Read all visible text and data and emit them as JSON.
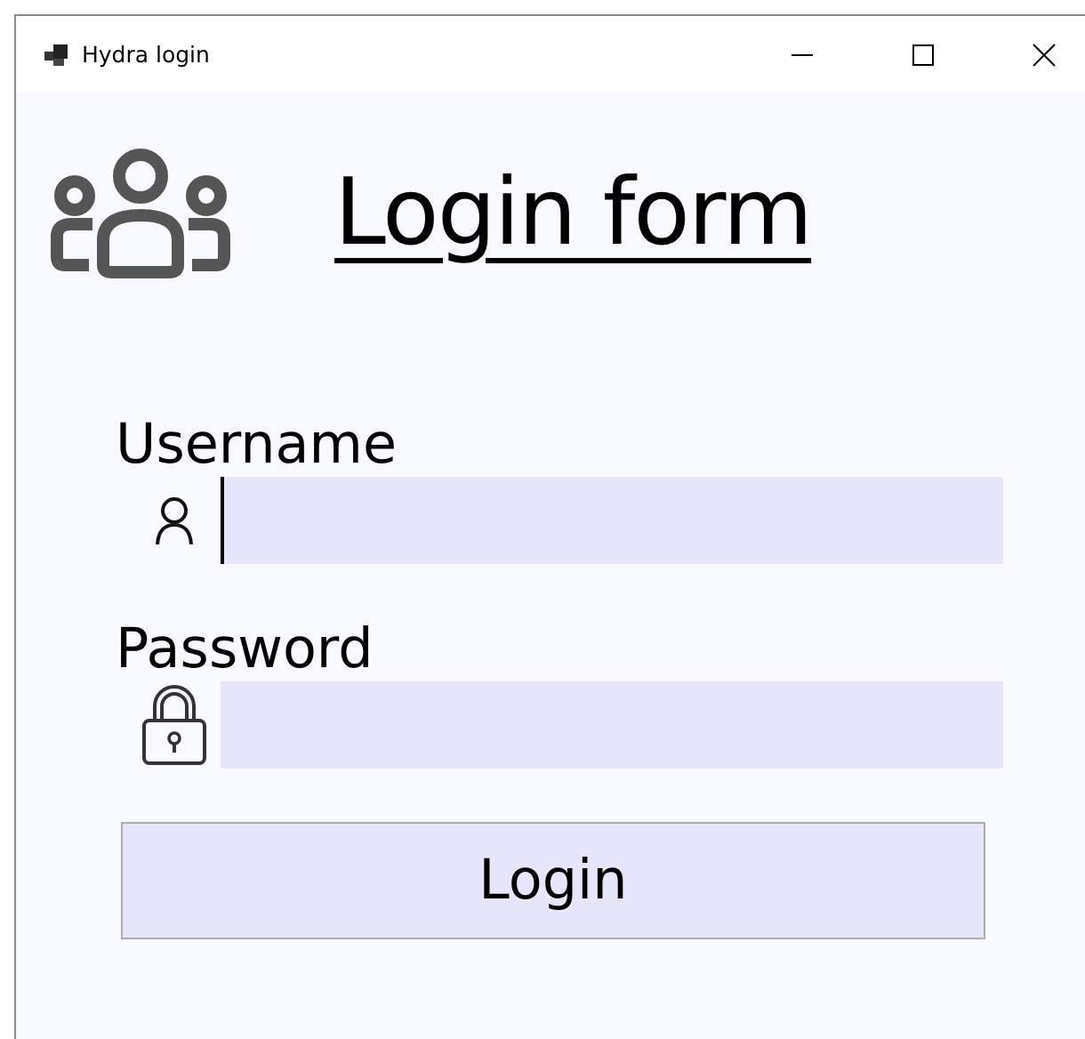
{
  "window": {
    "title": "Hydra login"
  },
  "heading": "Login form",
  "fields": [
    {
      "kind": "user",
      "label": "Username",
      "focused": true
    },
    {
      "kind": "lock",
      "label": "Password",
      "focused": false
    }
  ],
  "button": "Login"
}
